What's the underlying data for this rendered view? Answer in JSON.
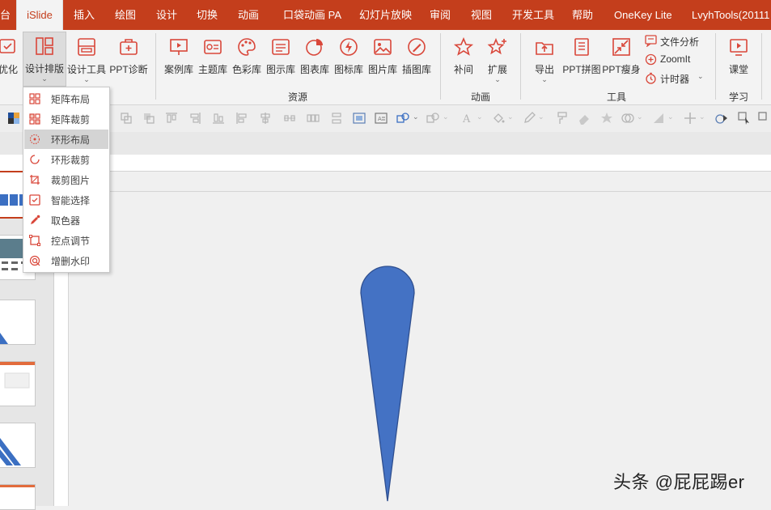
{
  "tabs": [
    "台",
    "iSlide",
    "插入",
    "绘图",
    "设计",
    "切换",
    "动画",
    "口袋动画 PA",
    "幻灯片放映",
    "审阅",
    "视图",
    "开发工具",
    "帮助",
    "OneKey Lite",
    "LvyhTools(20111"
  ],
  "active_tab": "iSlide",
  "ribbon": {
    "buttons": {
      "optimize": "优化",
      "design_layout": "设计排版",
      "design_tools": "设计工具",
      "ppt_diagnose": "PPT诊断",
      "case_lib": "案例库",
      "theme_lib": "主题库",
      "color_lib": "色彩库",
      "diagram_lib": "图示库",
      "chart_lib": "图表库",
      "icon_lib": "图标库",
      "image_lib": "图片库",
      "illustration_lib": "插图库",
      "tween": "补间",
      "extend": "扩展",
      "export": "导出",
      "ppt_collage": "PPT拼图",
      "ppt_slim": "PPT瘦身",
      "class": "课堂"
    },
    "small_buttons": {
      "file_analysis": "文件分析",
      "zoomit": "ZoomIt",
      "timer": "计时器"
    },
    "groups": {
      "resources": "资源",
      "animation": "动画",
      "tools": "工具",
      "learning": "学习"
    }
  },
  "dropdown": {
    "items": [
      "矩阵布局",
      "矩阵裁剪",
      "环形布局",
      "环形裁剪",
      "裁剪图片",
      "智能选择",
      "取色器",
      "控点调节",
      "增删水印"
    ],
    "highlighted": "环形布局"
  },
  "watermark": "头条 @屁屁踢er",
  "colors": {
    "brand": "#c43e1c",
    "icon": "#d9473a",
    "shape_fill": "#4472c4",
    "shape_stroke": "#2f4f8f"
  }
}
